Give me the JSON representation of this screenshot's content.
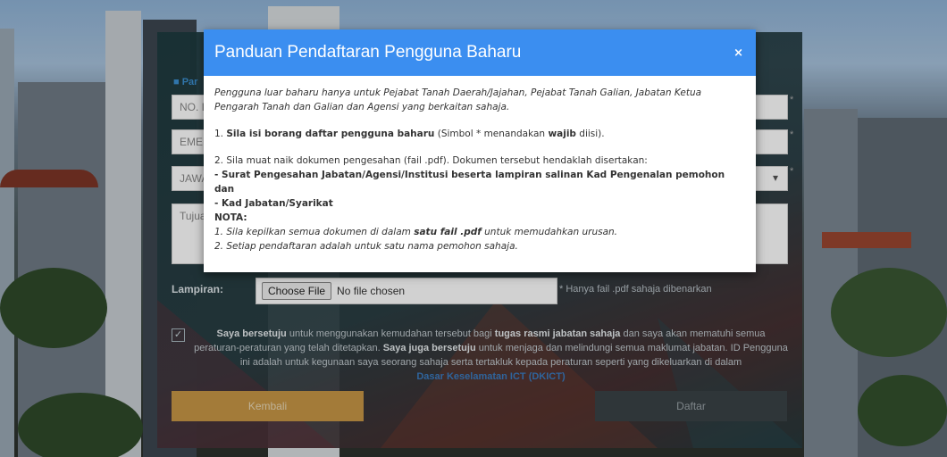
{
  "modal": {
    "title": "Panduan Pendaftaran Pengguna Baharu",
    "close_icon": "×",
    "intro": "Pengguna luar baharu hanya untuk Pejabat Tanah Daerah/Jajahan, Pejabat Tanah Galian, Jabatan Ketua Pengarah Tanah dan Galian dan Agensi yang berkaitan sahaja.",
    "step1": {
      "number": "1.",
      "bold": "Sila isi borang daftar pengguna baharu",
      "rest_before": "(Simbol * menandakan",
      "wajib": "wajib",
      "rest_after": "diisi)."
    },
    "step2": {
      "text": "2. Sila muat naik dokumen pengesahan (fail .pdf). Dokumen tersebut hendaklah disertakan:",
      "item1": "- Surat Pengesahan Jabatan/Agensi/Institusi beserta lampiran salinan Kad Pengenalan pemohon dan",
      "item2": "- Kad Jabatan/Syarikat"
    },
    "nota": {
      "heading": "NOTA:",
      "item1_before": "1. Sila kepilkan semua dokumen di dalam",
      "item1_bold": "satu fail .pdf",
      "item1_after": "untuk memudahkan urusan.",
      "item2": "2. Setiap pendaftaran adalah untuk satu nama pemohon sahaja."
    }
  },
  "form": {
    "section_head": "■ Par",
    "fields": {
      "no_placeholder": "NO. I",
      "email_placeholder": "EMEL",
      "jawatan_placeholder": "JAWA",
      "tujuan_placeholder": "Tujua"
    },
    "lampiran_label": "Lampiran:",
    "choose_file": "Choose File",
    "no_file": "No file chosen",
    "file_hint": "* Hanya fail .pdf sahaja dibenarkan",
    "agree": {
      "check": "✓",
      "b1": "Saya bersetuju",
      "t1": "untuk menggunakan kemudahan tersebut bagi",
      "b2": "tugas rasmi jabatan sahaja",
      "t2": "dan saya akan mematuhi semua peraturan-peraturan yang telah ditetapkan.",
      "b3": "Saya juga bersetuju",
      "t3": "untuk menjaga dan melindungi semua maklumat jabatan. ID Pengguna ini adalah untuk kegunaan saya seorang sahaja serta tertakluk kepada peraturan seperti yang dikeluarkan di dalam",
      "link": "Dasar Keselamatan ICT (DKICT)"
    },
    "back_button": "Kembali",
    "register_button": "Daftar",
    "req_star": "*"
  },
  "colors": {
    "modal_header": "#3b8ef0",
    "back_button": "#c79746",
    "register_button": "#3a4246"
  }
}
